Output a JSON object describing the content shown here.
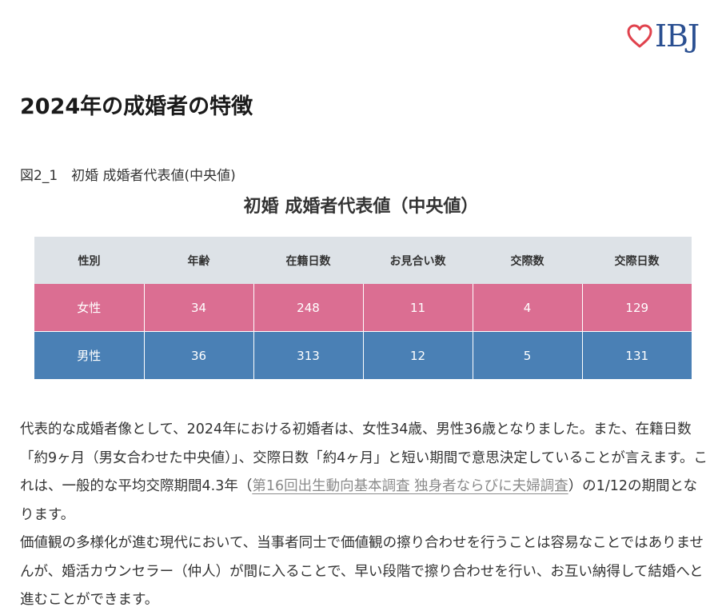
{
  "logo": {
    "text": "IBJ",
    "heart_color": "#e0424d",
    "text_color": "#2a4f91"
  },
  "page_title": "2024年の成婚者の特徴",
  "figure_caption": "図2_1　初婚 成婚者代表値(中央値)",
  "chart_title": "初婚 成婚者代表値（中央値）",
  "table": {
    "headers": [
      "性別",
      "年齢",
      "在籍日数",
      "お見合い数",
      "交際数",
      "交際日数"
    ],
    "rows": [
      {
        "cells": [
          "女性",
          "34",
          "248",
          "11",
          "4",
          "129"
        ],
        "color": "#db6e92"
      },
      {
        "cells": [
          "男性",
          "36",
          "313",
          "12",
          "5",
          "131"
        ],
        "color": "#4a80b5"
      }
    ],
    "header_bg": "#dde2e7"
  },
  "body": {
    "p1_before_link": "代表的な成婚者像として、2024年における初婚者は、女性34歳、男性36歳となりました。また、在籍日数「約9ヶ月（男女合わせた中央値）」、交際日数「約4ヶ月」と短い期間で意思決定していることが言えます。これは、一般的な平均交際期間4.3年（",
    "p1_link": "第16回出生動向基本調査 独身者ならびに夫婦調査",
    "p1_after_link": "）の1/12の期間となります。",
    "p2": "価値観の多様化が進む現代において、当事者同士で価値観の擦り合わせを行うことは容易なことではありませんが、婚活カウンセラー（仲人）が間に入ることで、早い段階で擦り合わせを行い、お互い納得して結婚へと進むことができます。"
  }
}
